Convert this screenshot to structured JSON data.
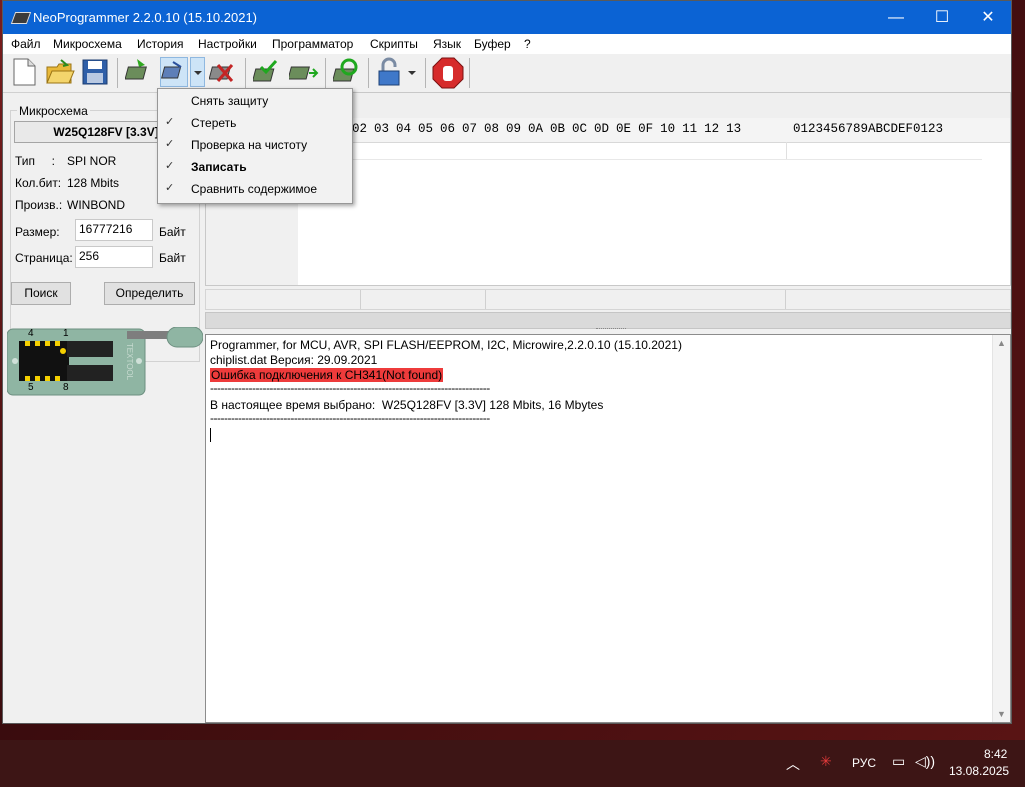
{
  "window": {
    "title": "NeoProgrammer 2.2.0.10 (15.10.2021)",
    "minimize": "—",
    "maximize": "☐",
    "close": "✕"
  },
  "menu": [
    "Файл",
    "Микросхема",
    "История",
    "Настройки",
    "Программатор",
    "Скрипты",
    "Язык",
    "Буфер",
    "?"
  ],
  "toolbar_icons": [
    "new-file-icon",
    "open-folder-icon",
    "save-icon",
    "read-chip-icon",
    "auto-chip-icon",
    "dropdown-arrow-icon",
    "erase-chip-icon",
    "write-chip-icon",
    "verify-chip-icon",
    "blank-check-icon",
    "protect-lock-icon",
    "lock-dropdown-icon",
    "stop-hand-icon"
  ],
  "dropdown": {
    "items": [
      {
        "label": "Снять защиту",
        "checked": false,
        "bold": false
      },
      {
        "label": "Стереть",
        "checked": true,
        "bold": false
      },
      {
        "label": "Проверка на чистоту",
        "checked": true,
        "bold": false
      },
      {
        "label": "Записать",
        "checked": true,
        "bold": true
      },
      {
        "label": "Сравнить содержимое",
        "checked": true,
        "bold": false
      }
    ],
    "check_glyph": "✓"
  },
  "chip": {
    "group_title": "Микросхема",
    "name": "W25Q128FV [3.3V]",
    "type_label": "Тип     :",
    "type_value": "SPI NOR",
    "bits_label": "Кол.бит:",
    "bits_value": "128 Mbits",
    "vendor_label": "Произв.:",
    "vendor_value": "WINBOND",
    "size_label": "Размер:",
    "size_value": "16777216",
    "size_unit": "Байт",
    "page_label": "Страница:",
    "page_value": "256",
    "page_unit": "Байт",
    "search_button": "Поиск",
    "detect_button": "Определить"
  },
  "adapter": {
    "pin_top_left": "4",
    "pin_top_right": "1",
    "pin_bottom_left": "5",
    "pin_bottom_right": "8",
    "brand": "TEXTOOL"
  },
  "hex": {
    "header_bytes": "02  03  04  05  06  07  08  09  0A  0B  0C  0D  0E  0F  10  11  12  13",
    "header_ascii": "0123456789ABCDEF0123"
  },
  "log": {
    "line1": "Programmer, for MCU, AVR, SPI FLASH/EEPROM, I2C, Microwire,2.2.0.10 (15.10.2021)",
    "line2": "chiplist.dat Версия: 29.09.2021",
    "line3_error": "Ошибка подключения к CH341(Not found)",
    "sep1": "--------------------------------------------------------------------------------",
    "line4": "В настоящее время выбрано:  W25Q128FV [3.3V] 128 Mbits, 16 Mbytes",
    "sep2": "--------------------------------------------------------------------------------",
    "error_color": "#ee3b3b"
  },
  "taskbar": {
    "lang": "РУС",
    "time": "8:42",
    "date": "13.08.2025"
  }
}
